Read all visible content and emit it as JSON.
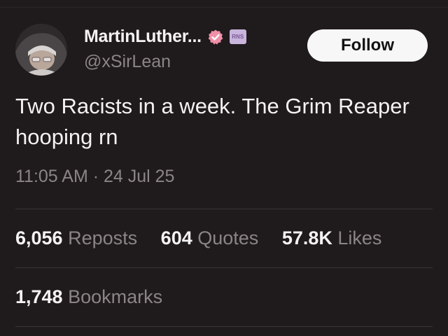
{
  "account": {
    "display_name": "MartinLuther...",
    "handle": "@xSirLean",
    "badge_text": "RNS",
    "verified_color": "#f08fa8"
  },
  "follow_label": "Follow",
  "tweet": {
    "text": "Two Racists in a week. The Grim Reaper hooping rn",
    "timestamp": "11:05 AM · 24 Jul 25"
  },
  "stats": {
    "reposts": {
      "count": "6,056",
      "label": "Reposts"
    },
    "quotes": {
      "count": "604",
      "label": "Quotes"
    },
    "likes": {
      "count": "57.8K",
      "label": "Likes"
    },
    "bookmarks": {
      "count": "1,748",
      "label": "Bookmarks"
    }
  }
}
